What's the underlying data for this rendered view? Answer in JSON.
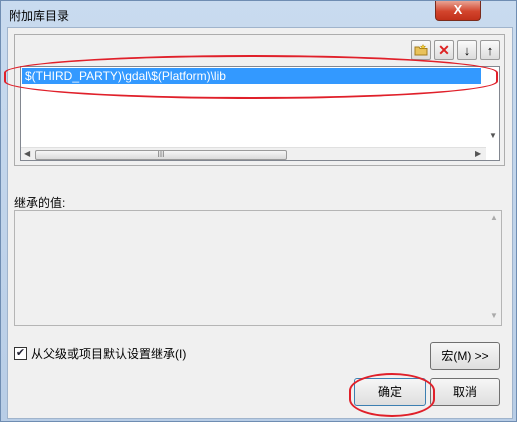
{
  "window": {
    "title": "附加库目录",
    "close_label": "X"
  },
  "toolbar": {
    "icons": [
      "new-folder-icon",
      "delete-icon",
      "move-down-icon",
      "move-up-icon"
    ],
    "delete_glyph": "✕",
    "down_glyph": "↓",
    "up_glyph": "↑"
  },
  "list": {
    "items": [
      "$(THIRD_PARTY)\\gdal\\$(Platform)\\lib"
    ],
    "hscroll_grip": "III"
  },
  "inherited": {
    "label": "继承的值:"
  },
  "options": {
    "inherit_checkbox_label": "从父级或项目默认设置继承(I)",
    "inherit_checked": true,
    "check_glyph": "✔"
  },
  "buttons": {
    "macros": "宏(M) >>",
    "ok": "确定",
    "cancel": "取消"
  },
  "colors": {
    "selection": "#3399ff",
    "annotation": "#e0202a",
    "close": "#c1301a"
  }
}
